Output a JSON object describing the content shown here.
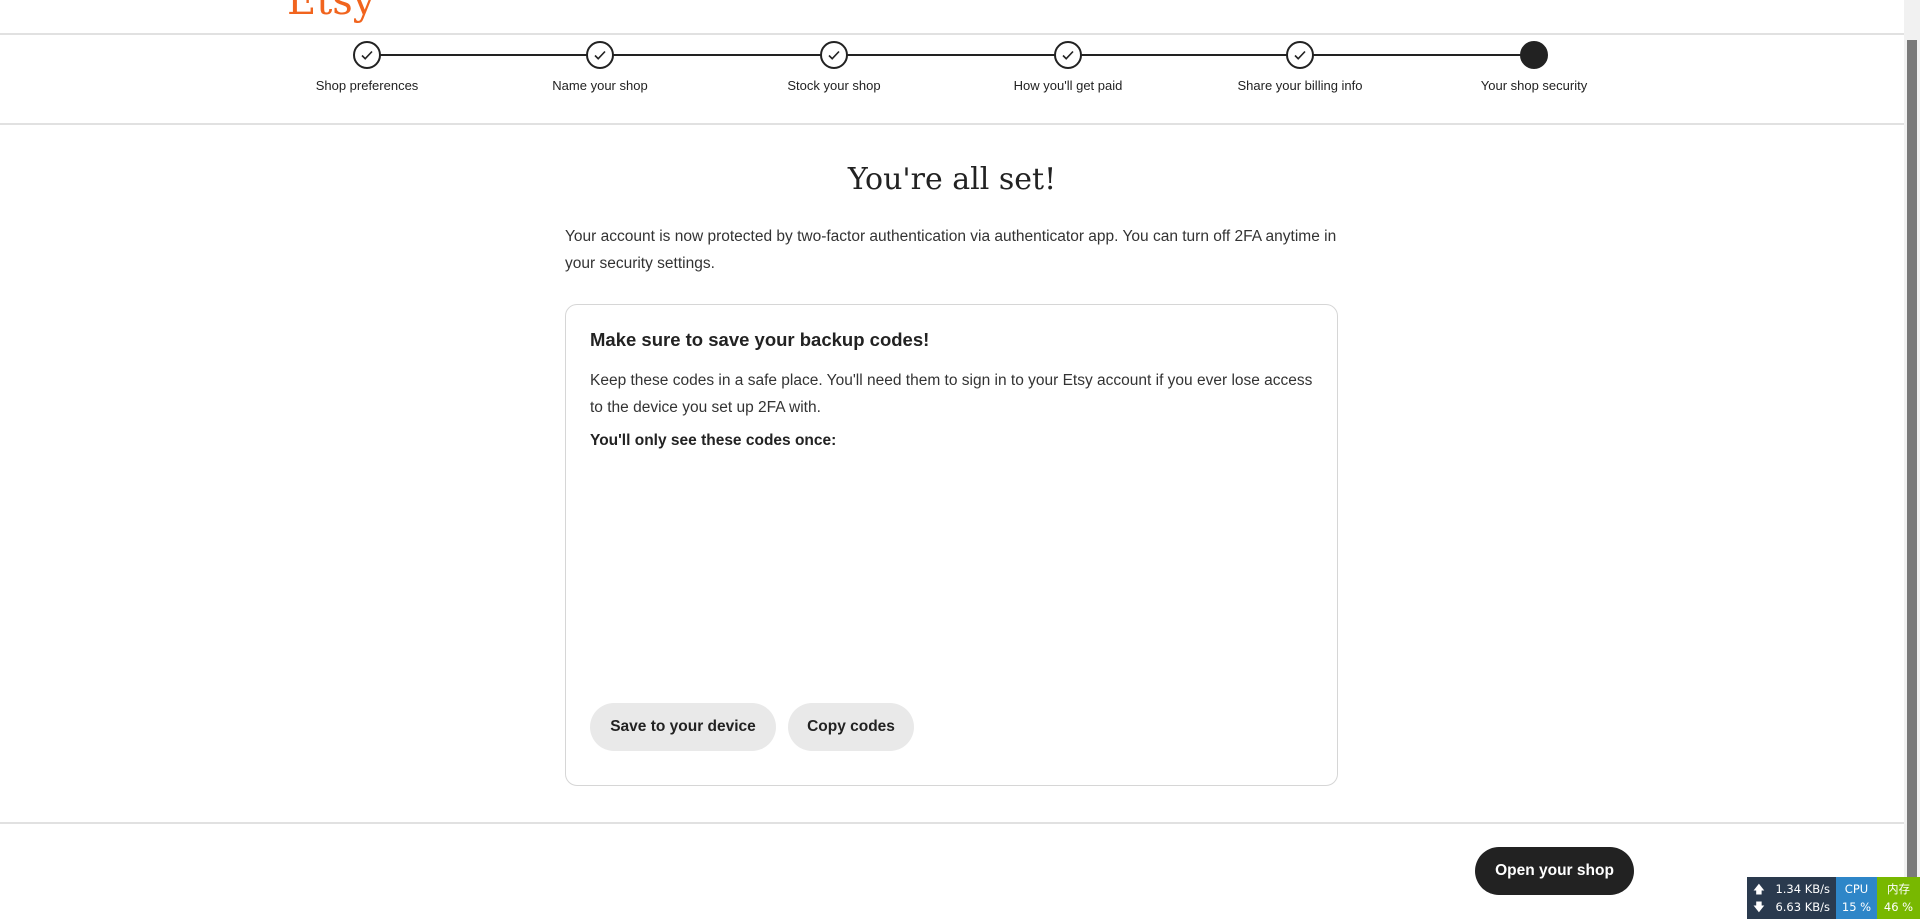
{
  "logo": "Etsy",
  "steps": [
    {
      "label": "Shop preferences",
      "state": "done"
    },
    {
      "label": "Name your shop",
      "state": "done"
    },
    {
      "label": "Stock your shop",
      "state": "done"
    },
    {
      "label": "How you'll get paid",
      "state": "done"
    },
    {
      "label": "Share your billing info",
      "state": "done"
    },
    {
      "label": "Your shop security",
      "state": "current"
    }
  ],
  "main": {
    "title": "You're all set!",
    "intro": "Your account is now protected by two-factor authentication via authenticator app. You can turn off 2FA anytime in your security settings.",
    "card": {
      "title": "Make sure to save your backup codes!",
      "body": "Keep these codes in a safe place. You'll need them to sign in to your Etsy account if you ever lose access to the device you set up 2FA with.",
      "note": "You'll only see these codes once:",
      "save_label": "Save to your device",
      "copy_label": "Copy codes"
    }
  },
  "footer": {
    "open_label": "Open your shop"
  },
  "monitor": {
    "up": "1.34 KB/s",
    "down": "6.63 KB/s",
    "cpu_label": "CPU",
    "cpu": "15 %",
    "mem_label": "内存",
    "mem": "46 %"
  },
  "colors": {
    "brand": "#f1641e",
    "dark": "#222222"
  }
}
